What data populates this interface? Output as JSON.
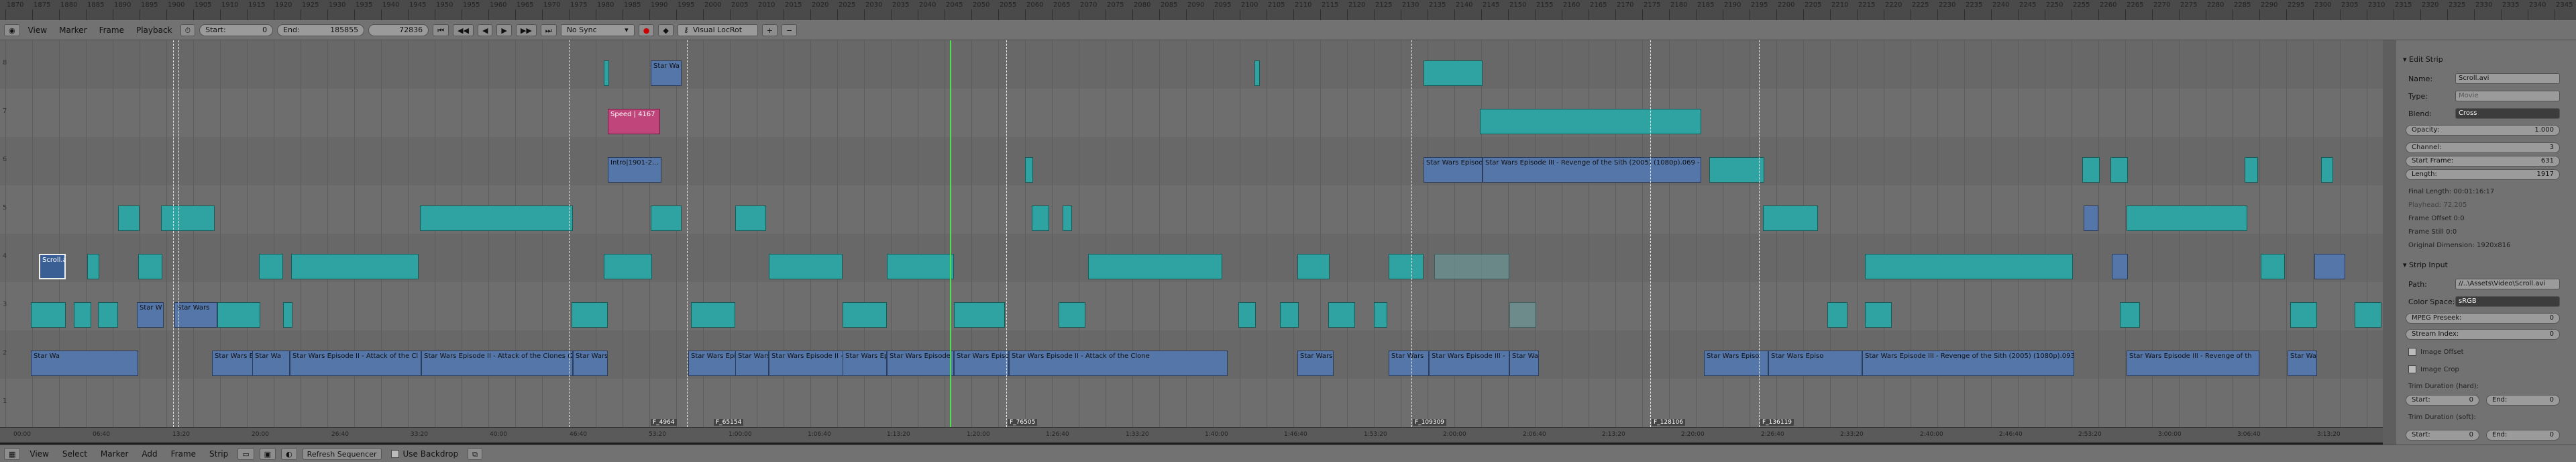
{
  "ruler_top": [
    "1870",
    "1875",
    "1880",
    "1885",
    "1890",
    "1895",
    "1900",
    "1905",
    "1910",
    "1915",
    "1920",
    "1925",
    "1930",
    "1935",
    "1940",
    "1945",
    "1950",
    "1955",
    "1960",
    "1965",
    "1970",
    "1975",
    "1980",
    "1985",
    "1990",
    "1995",
    "2000",
    "2005",
    "2010",
    "2015",
    "2020",
    "2025",
    "2030",
    "2035",
    "2040",
    "2045",
    "2050",
    "2055",
    "2060",
    "2065",
    "2070",
    "2075",
    "2080",
    "2085",
    "2090",
    "2095",
    "2100",
    "2105",
    "2110",
    "2115",
    "2120",
    "2125",
    "2130",
    "2135",
    "2140",
    "2145",
    "2150",
    "2155",
    "2160",
    "2165",
    "2170",
    "2175",
    "2180",
    "2185",
    "2190",
    "2195",
    "2200",
    "2205",
    "2210",
    "2215",
    "2220",
    "2225",
    "2230",
    "2235",
    "2240",
    "2245",
    "2250",
    "2255",
    "2260",
    "2265",
    "2270",
    "2275",
    "2280",
    "2285",
    "2290",
    "2295",
    "2300",
    "2305",
    "2310",
    "2315",
    "2320",
    "2325",
    "2330",
    "2335",
    "2340",
    "2345"
  ],
  "header": {
    "menus": [
      "View",
      "Marker",
      "Frame",
      "Playback"
    ],
    "start_label": "Start:",
    "start_value": "0",
    "end_label": "End:",
    "end_value": "185855",
    "current_frame": "72836",
    "sync": "No Sync",
    "keying_set": "Visual LocRot"
  },
  "channels": [
    "8",
    "7",
    "6",
    "5",
    "4",
    "3",
    "2",
    "1"
  ],
  "strips": {
    "ch7_a": "Star Wa",
    "ch6_speed": "Speed | 4167",
    "ch5_a": "Intro|1901-2...",
    "ch5_b": "Star Wars Episod",
    "ch5_c": "Star Wars Episode III - Revenge of the Sith (2005) (1080p).069 - E",
    "ch3_scroll": "Scroll.a",
    "ch2_a": "Star W",
    "ch2_b": "Star Wars",
    "ch1_a": "Star Wa",
    "ch1_b": "Star Wars Ep",
    "ch1_c": "Star Wa",
    "ch1_d": "Star Wars Episode II - Attack of the Cl",
    "ch1_e": "Star Wars Episode II - Attack of the Clones (20",
    "ch1_f": "Star Wars",
    "ch1_g": "Star Wars Epis",
    "ch1_h": "Star Wars",
    "ch1_i": "Star Wars Episode II -",
    "ch1_j": "Star Wars Ep",
    "ch1_k": "Star Wars Episode",
    "ch1_l": "Star Wars Episo",
    "ch1_m": "Star Wars Episode II - Attack of the Clone",
    "ch1_n": "Star Wars",
    "ch1_o": "Star Wars",
    "ch1_p": "Star Wars Episode III -",
    "ch1_q": "Star War",
    "ch1_r": "Star Wars Episo",
    "ch1_s": "Star Wars Episo",
    "ch1_t": "Star Wars Episode III - Revenge of the Sith (2005) (1080p).093",
    "ch1_u": "Star Wars Episode III - Revenge of th",
    "ch1_v": "Star Wa"
  },
  "markers": [
    "F_4964",
    "F_65154",
    "F_76505",
    "F_109309",
    "F_128106",
    "F_136119"
  ],
  "ruler_bottom": [
    "00:00",
    "06:40",
    "13:20",
    "20:00",
    "26:40",
    "33:20",
    "40:00",
    "46:40",
    "53:20",
    "1:00:00",
    "1:06:40",
    "1:13:20",
    "1:20:00",
    "1:26:40",
    "1:33:20",
    "1:40:00",
    "1:46:40",
    "1:53:20",
    "2:00:00",
    "2:06:40",
    "2:13:20",
    "2:20:00",
    "2:26:40",
    "2:33:20",
    "2:40:00",
    "2:46:40",
    "2:53:20",
    "3:00:00",
    "3:06:40",
    "3:13:20"
  ],
  "footer": {
    "menus": [
      "View",
      "Select",
      "Marker",
      "Add",
      "Frame",
      "Strip"
    ],
    "refresh": "Refresh Sequencer",
    "backdrop": "Use Backdrop"
  },
  "panel": {
    "edit_strip": "Edit Strip",
    "name_label": "Name:",
    "name_value": "Scroll.avi",
    "type_label": "Type:",
    "type_value": "Movie",
    "blend_label": "Blend:",
    "blend_value": "Cross",
    "opacity_label": "Opacity:",
    "opacity_value": "1.000",
    "channel_label": "Channel:",
    "channel_value": "3",
    "start_label": "Start Frame:",
    "start_value": "631",
    "length_label": "Length:",
    "length_value": "1917",
    "final_length": "Final Length: 00:01:16:17",
    "playhead": "Playhead: 72,205",
    "frame_offset": "Frame Offset 0:0",
    "frame_still": "Frame Still 0:0",
    "orig_dim": "Original Dimension: 1920x816",
    "strip_input": "Strip Input",
    "path_label": "Path:",
    "path_value": "//..\\Assets\\Video\\Scroll.avi",
    "colorspace_label": "Color Space:",
    "colorspace_value": "sRGB",
    "mpeg_proxy": "MPEG Preseek:",
    "mpeg_proxy_value": "0",
    "stream_index": "Stream Index:",
    "stream_index_value": "0",
    "image_offset": "Image Offset",
    "image_crop": "Image Crop",
    "trim_hard": "Trim Duration (hard):",
    "trim_soft": "Trim Duration (soft):",
    "trim_start": "Start:",
    "trim_start_value": "0",
    "trim_end": "End:",
    "trim_end_value": "0"
  },
  "colors": {
    "strip_movie": "#2fa3a1",
    "strip_meta": "#5576a8",
    "strip_speed": "#c0457a",
    "playhead": "#4ee04e"
  }
}
